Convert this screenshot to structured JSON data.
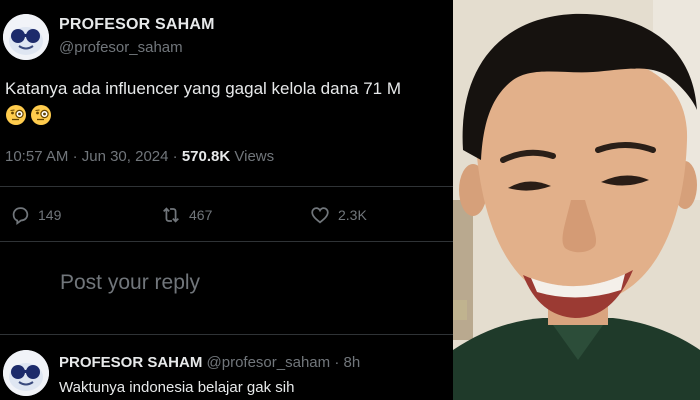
{
  "tweet": {
    "author_name": "PROFESOR SAHAM",
    "author_handle": "@profesor_saham",
    "text": "Katanya ada influencer yang gagal kelola dana 71 M",
    "emojis": [
      "face-with-monocle-emoji",
      "face-with-monocle-emoji"
    ],
    "time": "10:57 AM",
    "date": "Jun 30, 2024",
    "views_count": "570.8K",
    "views_label": "Views"
  },
  "actions": {
    "replies": "149",
    "reposts": "467",
    "likes": "2.3K"
  },
  "reply_box": {
    "placeholder": "Post your reply"
  },
  "reply": {
    "author_name": "PROFESOR SAHAM",
    "author_handle": "@profesor_saham",
    "age": "8h",
    "text": "Waktunya indonesia belajar gak sih"
  },
  "photo": {
    "description_icon": "smiling-man-photo"
  }
}
